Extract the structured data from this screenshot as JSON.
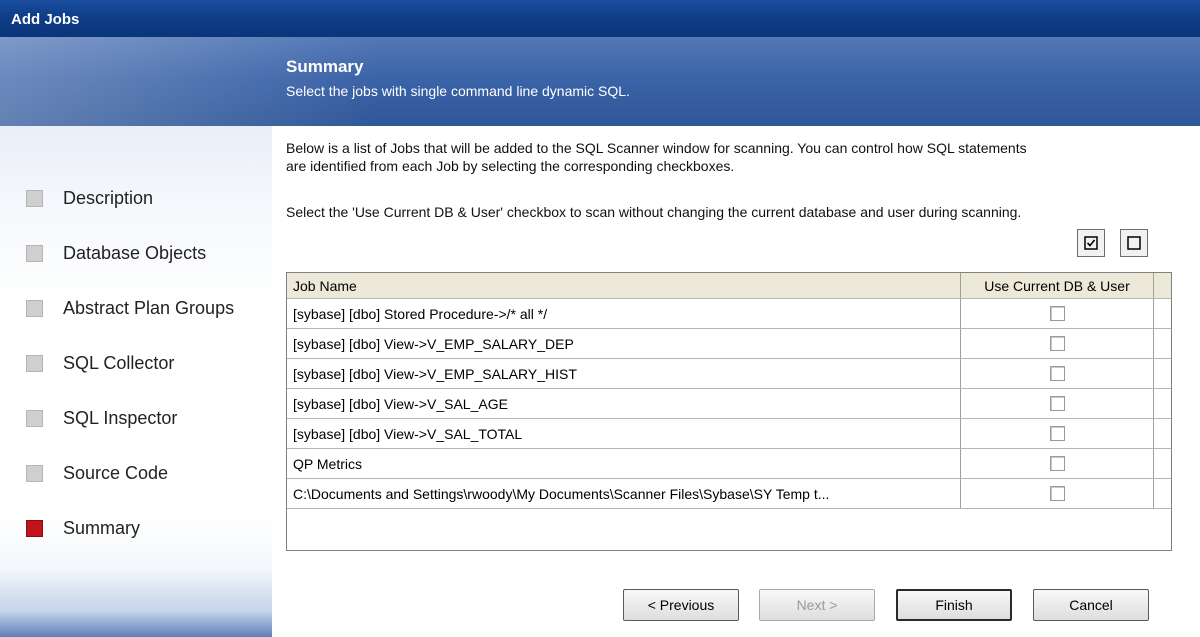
{
  "window": {
    "title": "Add Jobs"
  },
  "header": {
    "title": "Summary",
    "subtitle": "Select the jobs with single command line dynamic SQL."
  },
  "sidebar": {
    "items": [
      {
        "label": "Description",
        "active": false
      },
      {
        "label": "Database Objects",
        "active": false
      },
      {
        "label": "Abstract Plan Groups",
        "active": false
      },
      {
        "label": "SQL Collector",
        "active": false
      },
      {
        "label": "SQL Inspector",
        "active": false
      },
      {
        "label": "Source Code",
        "active": false
      },
      {
        "label": "Summary",
        "active": true
      }
    ]
  },
  "main": {
    "intro_line1": "Below is a list of Jobs that will be added to the SQL Scanner window for scanning. You can control how SQL statements",
    "intro_line2": "are identified from each Job by selecting the corresponding checkboxes.",
    "instruction": "Select the 'Use Current DB & User' checkbox to scan without changing the current database and user during scanning.",
    "select_all_icon": "checked-box-icon",
    "clear_all_icon": "empty-box-icon"
  },
  "table": {
    "columns": [
      "Job Name",
      "Use Current DB & User"
    ],
    "rows": [
      {
        "name": "[sybase] [dbo] Stored Procedure->/* all */",
        "checked": false
      },
      {
        "name": "[sybase] [dbo] View->V_EMP_SALARY_DEP",
        "checked": false
      },
      {
        "name": "[sybase] [dbo] View->V_EMP_SALARY_HIST",
        "checked": false
      },
      {
        "name": "[sybase] [dbo] View->V_SAL_AGE",
        "checked": false
      },
      {
        "name": "[sybase] [dbo] View->V_SAL_TOTAL",
        "checked": false
      },
      {
        "name": "QP Metrics",
        "checked": false
      },
      {
        "name": "C:\\Documents and Settings\\rwoody\\My Documents\\Scanner Files\\Sybase\\SY Temp t...",
        "checked": false
      }
    ]
  },
  "buttons": {
    "previous": "< Previous",
    "next": "Next >",
    "finish": "Finish",
    "cancel": "Cancel"
  },
  "colors": {
    "title_bar": "#0e3c86",
    "header_band": "#3b63a8",
    "active_step": "#c0131a",
    "inactive_step": "#cfcfcf"
  }
}
